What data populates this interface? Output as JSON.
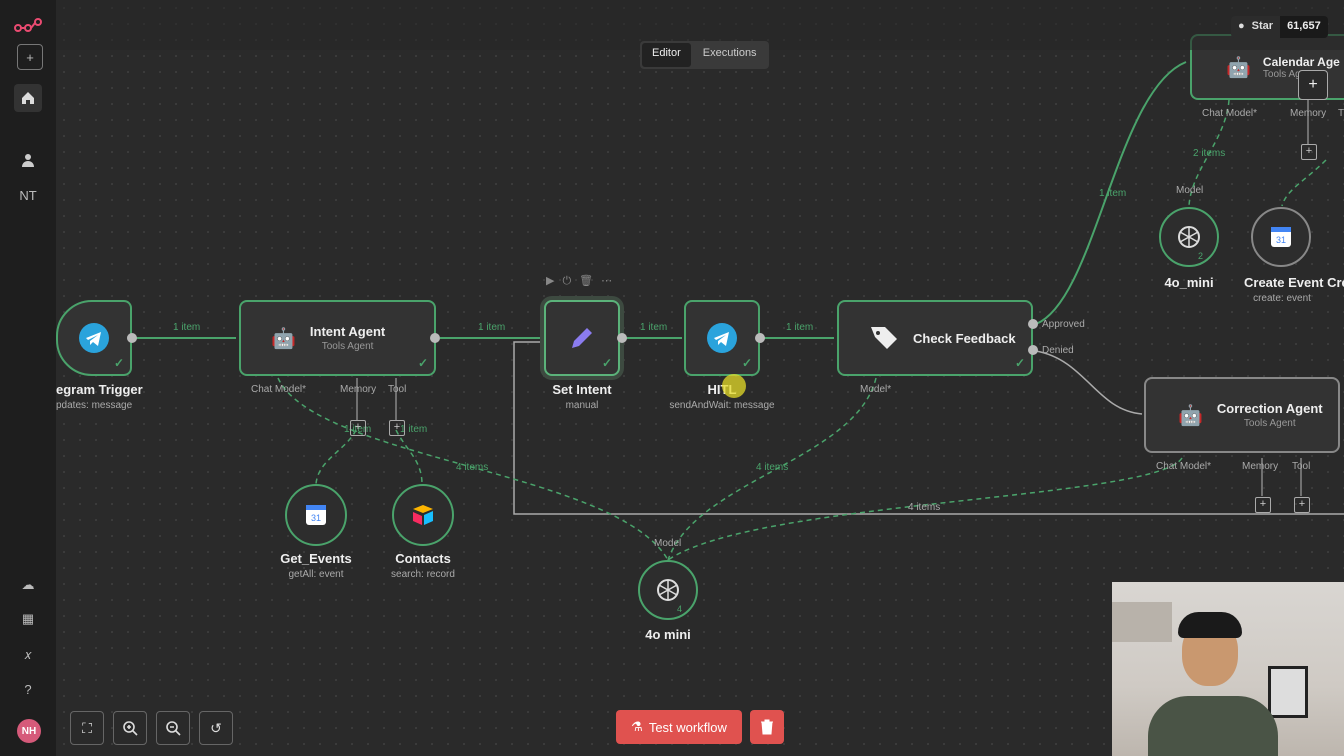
{
  "header": {
    "tabs": [
      {
        "label": "Editor",
        "active": true
      },
      {
        "label": "Executions",
        "active": false
      }
    ],
    "github": {
      "star_label": "Star",
      "count": "61,657"
    }
  },
  "sidebar": {
    "initials": "NT",
    "avatar": "NH"
  },
  "nodes": {
    "trigger": {
      "title": "egram Trigger",
      "subtitle": "pdates: message"
    },
    "intent_agent": {
      "title": "Intent Agent",
      "subtitle": "Tools Agent",
      "ports": [
        "Chat Model*",
        "Memory",
        "Tool"
      ]
    },
    "set_intent": {
      "title": "Set Intent",
      "subtitle": "manual"
    },
    "hitl": {
      "title": "HITL",
      "subtitle": "sendAndWait: message"
    },
    "check_feedback": {
      "title": "Check Feedback",
      "port_model": "Model*",
      "out_approved": "Approved",
      "out_denied": "Denied"
    },
    "correction_agent": {
      "title": "Correction Agent",
      "subtitle": "Tools Agent",
      "ports": [
        "Chat Model*",
        "Memory",
        "Tool"
      ]
    },
    "calendar_agent": {
      "title": "Calendar Age",
      "subtitle": "Tools Agent",
      "ports": [
        "Chat Model*",
        "Memory",
        "T"
      ]
    },
    "get_events": {
      "title": "Get_Events",
      "subtitle": "getAll: event"
    },
    "contacts": {
      "title": "Contacts",
      "subtitle": "search: record"
    },
    "model_main": {
      "title": "4o mini",
      "port": "Model",
      "badge": "4"
    },
    "model_cal": {
      "title": "4o_mini",
      "port": "Model",
      "badge": "2"
    },
    "create_event": {
      "title": "Create Event Crea",
      "subtitle": "create: event"
    }
  },
  "edge_labels": {
    "e1": "1 item",
    "e2": "1 item",
    "e3": "1 item",
    "e4": "1 item",
    "e5": "1 item",
    "e6": "2 items",
    "e7": "4 items",
    "e8": "4 items",
    "e9": "4 items",
    "e10": "1 item",
    "e11": "1 item"
  },
  "bottom": {
    "test_label": "Test workflow"
  },
  "colors": {
    "accent": "#4aa36b",
    "danger": "#e0524f",
    "canvas": "#2a2a2a"
  }
}
